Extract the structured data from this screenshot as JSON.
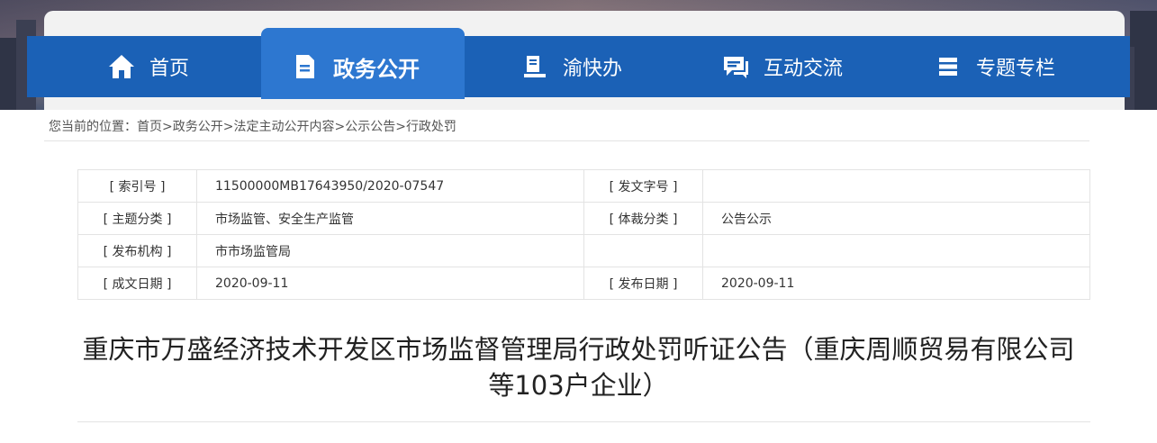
{
  "nav": {
    "items": [
      {
        "label": "首页",
        "icon": "home-icon"
      },
      {
        "label": "政务公开",
        "icon": "document-icon",
        "active": true
      },
      {
        "label": "渝快办",
        "icon": "service-desk-icon"
      },
      {
        "label": "互动交流",
        "icon": "chat-icon"
      },
      {
        "label": "专题专栏",
        "icon": "stack-icon"
      }
    ]
  },
  "breadcrumb": {
    "prefix": "您当前的位置：",
    "items": [
      "首页",
      "政务公开",
      "法定主动公开内容",
      "公示公告",
      "行政处罚"
    ],
    "separator": ">"
  },
  "info": {
    "index_label": "[ 索引号 ]",
    "index_value": "11500000MB17643950/2020-07547",
    "docno_label": "[ 发文字号 ]",
    "docno_value": "",
    "topic_label": "[ 主题分类 ]",
    "topic_value": "市场监管、安全生产监管",
    "genre_label": "[ 体裁分类 ]",
    "genre_value": "公告公示",
    "publisher_label": "[ 发布机构 ]",
    "publisher_value": "市市场监管局",
    "created_label": "[ 成文日期 ]",
    "created_value": "2020-09-11",
    "published_label": "[ 发布日期 ]",
    "published_value": "2020-09-11"
  },
  "article": {
    "title_line1": "重庆市万盛经济技术开发区市场监督管理局行政处罚听证公告（重庆周顺贸易有限公司",
    "title_line2": "等103户企业）"
  },
  "colors": {
    "nav_bar": "#1b61b6",
    "nav_active": "#2d77d0"
  }
}
